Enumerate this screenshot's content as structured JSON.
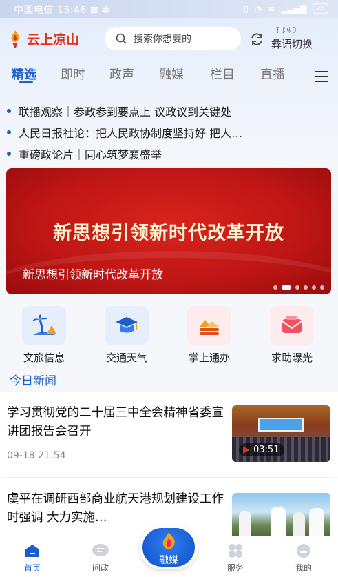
{
  "status_bar": {
    "carrier_time": "中国电信 15:46 ⊠ ✻",
    "battery": "26"
  },
  "header": {
    "app_name": "云上凉山",
    "search_placeholder": "搜索你想要的",
    "lang_script": "ꆈꌠꁱꂷ",
    "lang_switch": "彝语切换"
  },
  "tabs": [
    "精选",
    "即时",
    "政声",
    "融媒",
    "栏目",
    "直播"
  ],
  "active_tab": "精选",
  "headlines": [
    "联播观察｜参政参到要点上 议政议到关键处",
    "人民日报社论：把人民政协制度坚持好 把人…",
    "重磅政论片｜同心筑梦襄盛举"
  ],
  "banner": {
    "title": "新思想引领新时代改革开放",
    "caption": "新思想引领新时代改革开放",
    "slide_count": 6,
    "active_slide": 2
  },
  "quick_links": [
    {
      "label": "文旅信息",
      "icon": "palm-tree-icon",
      "color": "#e6edfb"
    },
    {
      "label": "交通天气",
      "icon": "graduation-cap-icon",
      "color": "#e6edfb"
    },
    {
      "label": "掌上通办",
      "icon": "hills-icon",
      "color": "#fdecee"
    },
    {
      "label": "求助曝光",
      "icon": "envelope-icon",
      "color": "#fdecee"
    }
  ],
  "section_title": "今日新闻",
  "news": [
    {
      "title": "学习贯彻党的二十届三中全会精神省委宣讲团报告会召开",
      "time": "09-18 21:54",
      "video_duration": "03:51"
    },
    {
      "title": "虞平在调研西部商业航天港规划建设工作时强调 大力实施…",
      "time": ""
    }
  ],
  "bottom_nav": [
    {
      "label": "首页",
      "icon": "home-icon"
    },
    {
      "label": "问政",
      "icon": "chat-icon"
    },
    {
      "label": "融媒",
      "icon": "flame-icon"
    },
    {
      "label": "服务",
      "icon": "grid-icon"
    },
    {
      "label": "我的",
      "icon": "user-icon"
    }
  ],
  "colors": {
    "accent": "#1a5fcc",
    "brand_red": "#e0301e",
    "banner_red": "#c01616"
  }
}
